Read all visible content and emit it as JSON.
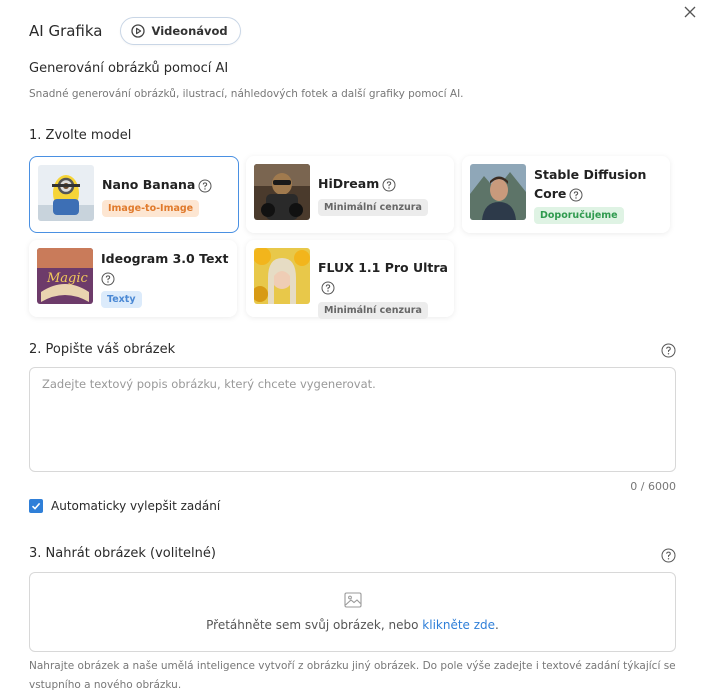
{
  "header": {
    "title": "AI Grafika",
    "video_button_label": "Videonávod"
  },
  "intro": {
    "subtitle": "Generování obrázků pomocí AI",
    "description": "Snadné generování obrázků, ilustrací, náhledových fotek a další grafiky pomocí AI."
  },
  "model_section": {
    "label": "1. Zvolte model",
    "models": [
      {
        "name": "Nano Banana",
        "badge": "Image-to-Image",
        "badge_color": "#e07a2c",
        "selected": true
      },
      {
        "name": "HiDream",
        "badge": "Minimální cenzura",
        "badge_color": "#666666",
        "selected": false
      },
      {
        "name": "Stable Diffusion Core",
        "badge": "Doporučujeme",
        "badge_color": "#2f9a4e",
        "selected": false
      },
      {
        "name": "Ideogram 3.0 Text",
        "badge": "Texty",
        "badge_color": "#4a88d4",
        "selected": false
      },
      {
        "name": "FLUX 1.1 Pro Ultra",
        "badge": "Minimální cenzura",
        "badge_color": "#666666",
        "selected": false
      }
    ]
  },
  "describe_section": {
    "label": "2. Popište váš obrázek",
    "placeholder": "Zadejte textový popis obrázku, který chcete vygenerovat.",
    "counter": "0 / 6000"
  },
  "enhance": {
    "label": "Automaticky vylepšit zadání",
    "checked": true
  },
  "upload_section": {
    "label": "3. Nahrát obrázek (volitelné)",
    "drop_text": "Přetáhněte sem svůj obrázek, nebo ",
    "drop_link": "klikněte zde",
    "drop_suffix": ".",
    "footnote": "Nahrajte obrázek a naše umělá inteligence vytvoří z obrázku jiný obrázek. Do pole výše zadejte i textové zadání týkající se vstupního a nového obrázku."
  },
  "colors": {
    "accent": "#2f7fd8",
    "selected_border": "#4a90e2"
  }
}
